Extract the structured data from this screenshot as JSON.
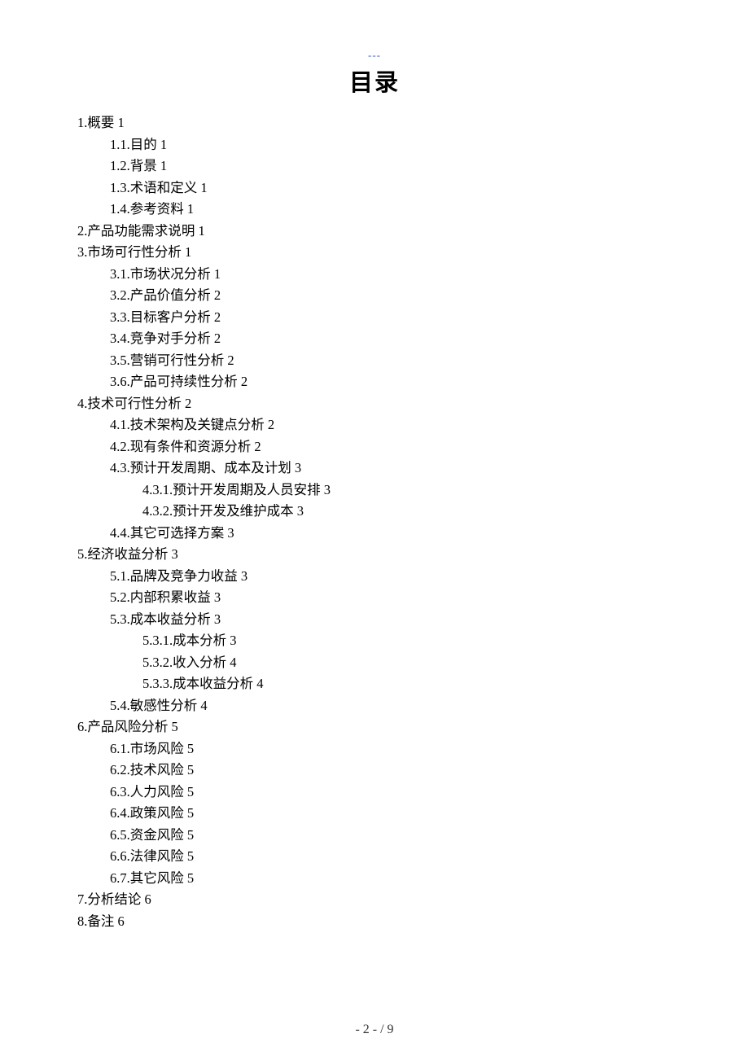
{
  "header_mark": "---",
  "title": "目录",
  "toc": [
    {
      "level": 1,
      "num": "1.",
      "text": "概要",
      "page": "1"
    },
    {
      "level": 2,
      "num": "1.1.",
      "text": "目的",
      "page": "1"
    },
    {
      "level": 2,
      "num": "1.2.",
      "text": "背景",
      "page": "1"
    },
    {
      "level": 2,
      "num": "1.3.",
      "text": "术语和定义",
      "page": "1"
    },
    {
      "level": 2,
      "num": "1.4.",
      "text": "参考资料",
      "page": "1"
    },
    {
      "level": 1,
      "num": "2.",
      "text": "产品功能需求说明",
      "page": "1"
    },
    {
      "level": 1,
      "num": "3.",
      "text": "市场可行性分析",
      "page": "1"
    },
    {
      "level": 2,
      "num": "3.1.",
      "text": "市场状况分析",
      "page": "1"
    },
    {
      "level": 2,
      "num": "3.2.",
      "text": "产品价值分析",
      "page": "2"
    },
    {
      "level": 2,
      "num": "3.3.",
      "text": "目标客户分析",
      "page": "2"
    },
    {
      "level": 2,
      "num": "3.4.",
      "text": "竞争对手分析",
      "page": "2"
    },
    {
      "level": 2,
      "num": "3.5.",
      "text": "营销可行性分析",
      "page": "2"
    },
    {
      "level": 2,
      "num": "3.6.",
      "text": "产品可持续性分析",
      "page": "2"
    },
    {
      "level": 1,
      "num": "4.",
      "text": "技术可行性分析",
      "page": "2"
    },
    {
      "level": 2,
      "num": "4.1.",
      "text": "技术架构及关键点分析",
      "page": "2"
    },
    {
      "level": 2,
      "num": "4.2.",
      "text": "现有条件和资源分析",
      "page": "2"
    },
    {
      "level": 2,
      "num": "4.3.",
      "text": "预计开发周期、成本及计划",
      "page": "3"
    },
    {
      "level": 3,
      "num": "4.3.1.",
      "text": "预计开发周期及人员安排",
      "page": "3"
    },
    {
      "level": 3,
      "num": "4.3.2.",
      "text": "预计开发及维护成本",
      "page": "3"
    },
    {
      "level": 2,
      "num": "4.4.",
      "text": "其它可选择方案",
      "page": "3"
    },
    {
      "level": 1,
      "num": "5.",
      "text": "经济收益分析",
      "page": "3"
    },
    {
      "level": 2,
      "num": "5.1.",
      "text": "品牌及竞争力收益",
      "page": "3"
    },
    {
      "level": 2,
      "num": "5.2.",
      "text": "内部积累收益",
      "page": "3"
    },
    {
      "level": 2,
      "num": "5.3.",
      "text": "成本收益分析",
      "page": "3"
    },
    {
      "level": 3,
      "num": "5.3.1.",
      "text": "成本分析",
      "page": "3"
    },
    {
      "level": 3,
      "num": "5.3.2.",
      "text": "收入分析",
      "page": "4"
    },
    {
      "level": 3,
      "num": "5.3.3.",
      "text": "成本收益分析",
      "page": "4"
    },
    {
      "level": 2,
      "num": "5.4.",
      "text": "敏感性分析",
      "page": "4"
    },
    {
      "level": 1,
      "num": "6.",
      "text": "产品风险分析",
      "page": "5"
    },
    {
      "level": 2,
      "num": "6.1.",
      "text": "市场风险",
      "page": "5"
    },
    {
      "level": 2,
      "num": "6.2.",
      "text": "技术风险",
      "page": "5"
    },
    {
      "level": 2,
      "num": "6.3.",
      "text": "人力风险",
      "page": "5"
    },
    {
      "level": 2,
      "num": "6.4.",
      "text": "政策风险",
      "page": "5"
    },
    {
      "level": 2,
      "num": "6.5.",
      "text": "资金风险",
      "page": "5"
    },
    {
      "level": 2,
      "num": "6.6.",
      "text": "法律风险",
      "page": "5"
    },
    {
      "level": 2,
      "num": "6.7.",
      "text": "其它风险",
      "page": "5"
    },
    {
      "level": 1,
      "num": "7.",
      "text": "分析结论",
      "page": "6"
    },
    {
      "level": 1,
      "num": "8.",
      "text": "备注",
      "page": "6"
    }
  ],
  "pagenum": "- 2 - / 9"
}
